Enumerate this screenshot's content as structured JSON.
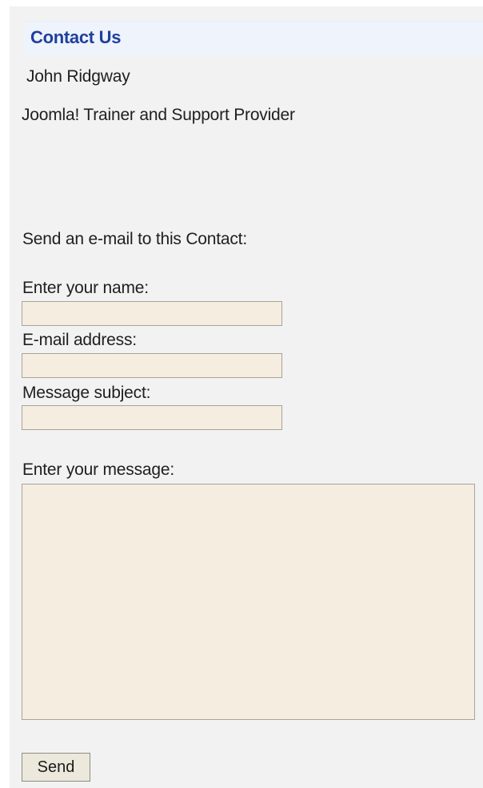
{
  "contact": {
    "heading": "Contact Us",
    "name": "John Ridgway",
    "position": "Joomla! Trainer and Support Provider"
  },
  "form": {
    "intro": "Send an e-mail to this Contact:",
    "name_label": "Enter your name:",
    "name_value": "",
    "email_label": "E-mail address:",
    "email_value": "",
    "subject_label": "Message subject:",
    "subject_value": "",
    "message_label": "Enter your message:",
    "message_value": "",
    "send_label": "Send"
  },
  "colors": {
    "heading_text": "#1f3f9e",
    "heading_background": "#eef3fc",
    "panel_background": "#f2f2f2",
    "field_background": "#f4ede0",
    "button_background": "#ece8dc"
  }
}
